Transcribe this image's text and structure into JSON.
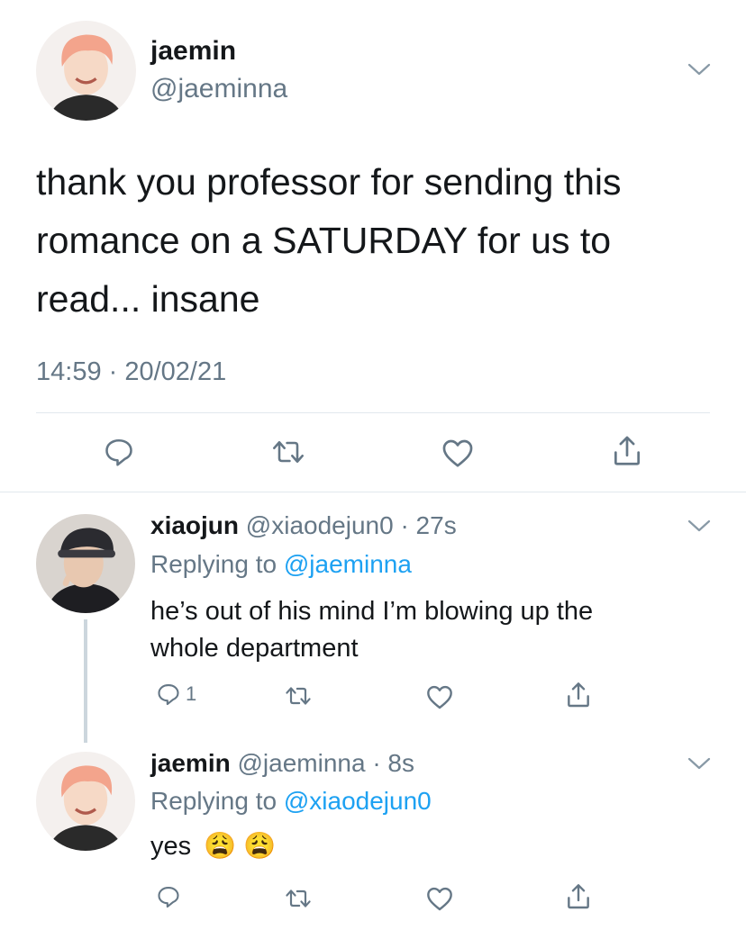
{
  "main_tweet": {
    "display_name": "jaemin",
    "handle": "@jaeminna",
    "text_lines": [
      "thank you professor for sending this",
      "romance on a SATURDAY for us to",
      "read... insane"
    ],
    "timestamp": "14:59 · 20/02/21",
    "actions": [
      "reply-icon",
      "retweet-icon",
      "like-icon",
      "share-icon"
    ]
  },
  "replies": [
    {
      "display_name": "xiaojun",
      "meta": "@xiaodejun0 · 27s",
      "replying_prefix": "Replying to",
      "replying_to": "@jaeminna",
      "text_lines": [
        "he’s out of his mind I’m blowing up the",
        "whole department"
      ],
      "reply_count": "1"
    },
    {
      "display_name": "jaemin",
      "meta": "@jaeminna · 8s",
      "replying_prefix": "Replying to",
      "replying_to": "@xiaodejun0",
      "text": "yes",
      "emoji": "😩 😩",
      "reply_count": ""
    }
  ],
  "colors": {
    "text": "#14171a",
    "muted": "#657786",
    "link": "#1da1f2",
    "divider": "#e1e8ed",
    "icon": "#657786"
  }
}
